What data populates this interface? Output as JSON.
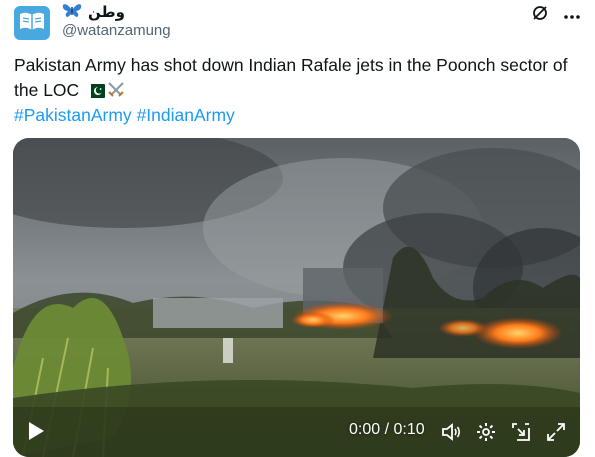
{
  "account": {
    "display_name": "وطن",
    "handle": "@watanzamung",
    "avatar_icon": "book-logo-icon",
    "name_emoji_icon": "butterfly-icon"
  },
  "top_actions": {
    "grok_icon": "grok-icon",
    "more_icon": "more-icon"
  },
  "tweet": {
    "text": "Pakistan Army has shot down Indian Rafale jets in the Poonch sector of the LOC",
    "emojis": [
      "pakistan-flag-icon",
      "crossed-swords-icon"
    ],
    "hashtags": [
      "#PakistanArmy",
      "#IndianArmy"
    ]
  },
  "video": {
    "time_display": "0:00 / 0:10",
    "progress": 0,
    "controls": [
      "play-icon",
      "volume-icon",
      "settings-icon",
      "minimize-icon",
      "fullscreen-icon"
    ]
  },
  "colors": {
    "link": "#1d9bf0",
    "text": "#0f1419",
    "secondary": "#536471",
    "avatar_bg": "#4aa8e0"
  }
}
